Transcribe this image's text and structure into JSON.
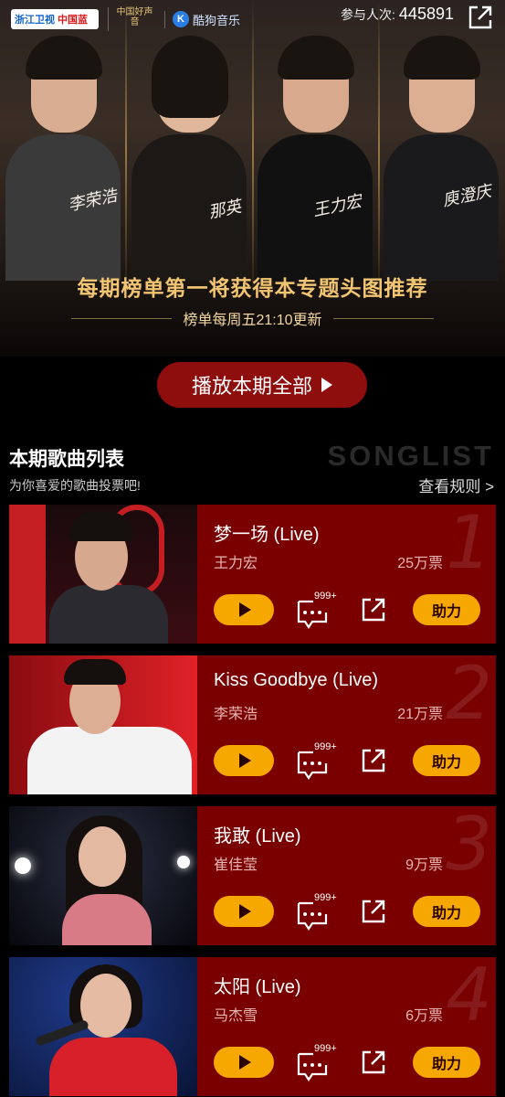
{
  "header": {
    "brand_zj_a": "浙江卫视",
    "brand_zj_b": "中国蓝",
    "brand_voice": "中国好声音",
    "brand_kugou_badge": "K",
    "brand_kugou": "酷狗音乐",
    "participants_label": "参与人次:",
    "participants_count": "445891"
  },
  "hero": {
    "judges": [
      {
        "name": "李荣浩"
      },
      {
        "name": "那英"
      },
      {
        "name": "王力宏"
      },
      {
        "name": "庾澄庆"
      }
    ],
    "headline": "每期榜单第一将获得本专题头图推荐",
    "subline": "榜单每周五21:10更新",
    "play_all_label": "播放本期全部"
  },
  "songlist": {
    "title": "本期歌曲列表",
    "watermark": "SONGLIST",
    "subtitle": "为你喜爱的歌曲投票吧!",
    "rules_link": "查看规则 >"
  },
  "songs": [
    {
      "rank": "1",
      "title": "梦一场 (Live)",
      "artist": "王力宏",
      "votes": "25万票",
      "comments": "999+",
      "boost_label": "助力"
    },
    {
      "rank": "2",
      "title": "Kiss Goodbye (Live)",
      "artist": "李荣浩",
      "votes": "21万票",
      "comments": "999+",
      "boost_label": "助力"
    },
    {
      "rank": "3",
      "title": "我敢 (Live)",
      "artist": "崔佳莹",
      "votes": "9万票",
      "comments": "999+",
      "boost_label": "助力"
    },
    {
      "rank": "4",
      "title": "太阳 (Live)",
      "artist": "马杰雪",
      "votes": "6万票",
      "comments": "999+",
      "boost_label": "助力"
    }
  ],
  "colors": {
    "card_bg": "#7a0000",
    "accent_gold": "#f6a800",
    "headline_gold": "#f2c572",
    "play_all_bg": "#8e0e0e"
  }
}
